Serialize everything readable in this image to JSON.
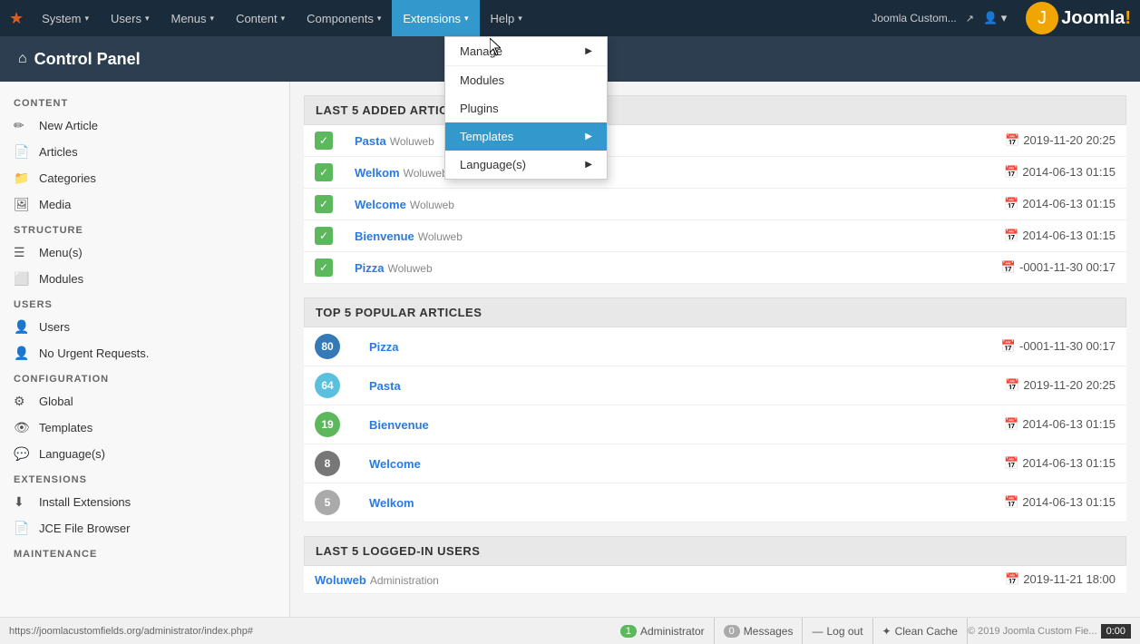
{
  "topbar": {
    "logo": "★",
    "nav_items": [
      {
        "id": "system",
        "label": "System",
        "has_arrow": true
      },
      {
        "id": "users",
        "label": "Users",
        "has_arrow": true
      },
      {
        "id": "menus",
        "label": "Menus",
        "has_arrow": true
      },
      {
        "id": "content",
        "label": "Content",
        "has_arrow": true
      },
      {
        "id": "components",
        "label": "Components",
        "has_arrow": true
      },
      {
        "id": "extensions",
        "label": "Extensions",
        "has_arrow": true,
        "active": true
      },
      {
        "id": "help",
        "label": "Help",
        "has_arrow": true
      }
    ],
    "site_name": "Joomla Custom...",
    "site_icon": "↗",
    "user_icon": "👤",
    "joomla_text": "Joomla!"
  },
  "control_panel": {
    "title": "Control Panel",
    "home_icon": "⌂"
  },
  "sidebar": {
    "sections": [
      {
        "id": "content",
        "title": "CONTENT",
        "items": [
          {
            "id": "new-article",
            "icon": "✏",
            "label": "New Article"
          },
          {
            "id": "articles",
            "icon": "📄",
            "label": "Articles"
          },
          {
            "id": "categories",
            "icon": "📁",
            "label": "Categories"
          },
          {
            "id": "media",
            "icon": "🖼",
            "label": "Media"
          }
        ]
      },
      {
        "id": "structure",
        "title": "STRUCTURE",
        "items": [
          {
            "id": "menus",
            "icon": "☰",
            "label": "Menu(s)"
          },
          {
            "id": "modules",
            "icon": "⬜",
            "label": "Modules"
          }
        ]
      },
      {
        "id": "users",
        "title": "USERS",
        "items": [
          {
            "id": "users",
            "icon": "👤",
            "label": "Users"
          },
          {
            "id": "no-urgent",
            "icon": "👤",
            "label": "No Urgent Requests."
          }
        ]
      },
      {
        "id": "configuration",
        "title": "CONFIGURATION",
        "items": [
          {
            "id": "global",
            "icon": "⚙",
            "label": "Global"
          },
          {
            "id": "templates",
            "icon": "👁",
            "label": "Templates"
          },
          {
            "id": "languages",
            "icon": "💬",
            "label": "Language(s)"
          }
        ]
      },
      {
        "id": "extensions",
        "title": "EXTENSIONS",
        "items": [
          {
            "id": "install-extensions",
            "icon": "⬇",
            "label": "Install Extensions"
          },
          {
            "id": "jce-file-browser",
            "icon": "📄",
            "label": "JCE File Browser"
          }
        ]
      },
      {
        "id": "maintenance",
        "title": "MAINTENANCE",
        "items": []
      }
    ]
  },
  "extensions_dropdown": {
    "items": [
      {
        "id": "manage",
        "label": "Manage",
        "has_arrow": true
      },
      {
        "id": "modules",
        "label": "Modules",
        "has_arrow": false
      },
      {
        "id": "plugins",
        "label": "Plugins",
        "has_arrow": false
      },
      {
        "id": "templates",
        "label": "Templates",
        "has_arrow": true,
        "active": true
      },
      {
        "id": "languages",
        "label": "Language(s)",
        "has_arrow": true
      }
    ]
  },
  "main_content": {
    "last5_added_title": "LAST 5 ADDED ARTICLES",
    "last5_added": [
      {
        "status": "✓",
        "title": "Pasta",
        "author": "Woluweb",
        "date": "2019-11-20 20:25"
      },
      {
        "status": "✓",
        "title": "Welkom",
        "author": "Woluweb",
        "date": "2014-06-13 01:15"
      },
      {
        "status": "✓",
        "title": "Welcome",
        "author": "Woluweb",
        "date": "2014-06-13 01:15"
      },
      {
        "status": "✓",
        "title": "Bienvenue",
        "author": "Woluweb",
        "date": "2014-06-13 01:15"
      },
      {
        "status": "✓",
        "title": "Pizza",
        "author": "Woluweb",
        "date": "-0001-11-30 00:17"
      }
    ],
    "top5_popular_title": "TOP 5 POPULAR ARTICLES",
    "top5_popular": [
      {
        "count": "80",
        "badge_class": "badge-blue",
        "title": "Pizza",
        "date": "-0001-11-30 00:17"
      },
      {
        "count": "64",
        "badge_class": "badge-teal",
        "title": "Pasta",
        "date": "2019-11-20 20:25"
      },
      {
        "count": "19",
        "badge_class": "badge-green",
        "title": "Bienvenue",
        "date": "2014-06-13 01:15"
      },
      {
        "count": "8",
        "badge_class": "badge-gray",
        "title": "Welcome",
        "date": "2014-06-13 01:15"
      },
      {
        "count": "5",
        "badge_class": "badge-light",
        "title": "Welkom",
        "date": "2014-06-13 01:15"
      }
    ],
    "last5_loggedin_title": "LAST 5 LOGGED-IN USERS",
    "last5_loggedin": [
      {
        "username": "Woluweb",
        "role": "Administration",
        "date": "2019-11-21 18:00"
      }
    ]
  },
  "statusbar": {
    "url": "https://joomlacustomfields.org/administrator/index.php#",
    "admin_label": "Administrator",
    "admin_count": "1",
    "messages_label": "Messages",
    "messages_count": "0",
    "logout_icon": "—",
    "logout_label": "Log out",
    "clean_cache_icon": "✦",
    "clean_cache_label": "Clean Cache",
    "copyright": "© 2019 Joomla Custom Fie...",
    "debug": "0:00"
  }
}
